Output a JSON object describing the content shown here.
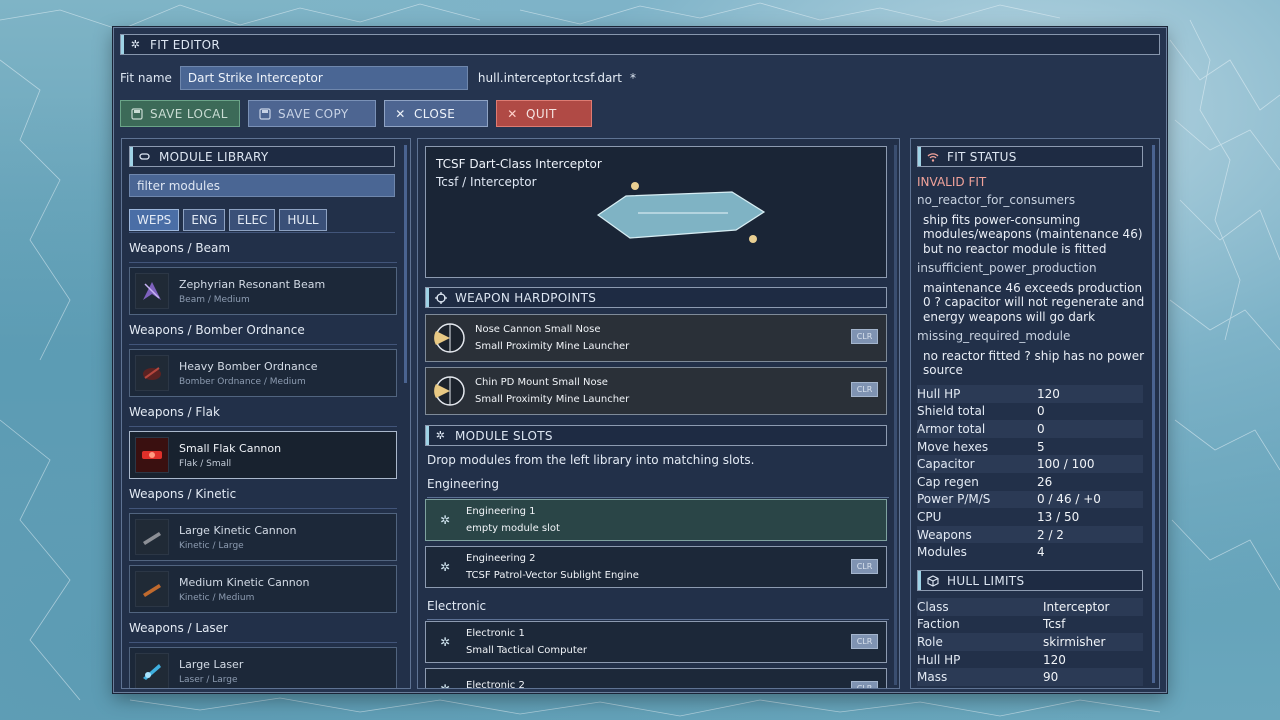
{
  "window": {
    "title": "FIT EDITOR"
  },
  "fit": {
    "name_label": "Fit name",
    "name_value": "Dart Strike Interceptor",
    "filename": "hull.interceptor.tcsf.dart",
    "dirty_marker": "*"
  },
  "toolbar": {
    "save_local": "SAVE LOCAL",
    "save_copy": "SAVE COPY",
    "close": "CLOSE",
    "quit": "QUIT"
  },
  "library": {
    "title": "MODULE LIBRARY",
    "filter_placeholder": "filter modules",
    "tabs": [
      "WEPS",
      "ENG",
      "ELEC",
      "HULL"
    ],
    "groups": [
      {
        "label": "Weapons / Beam",
        "items": [
          {
            "name": "Zephyrian Resonant Beam",
            "sub": "Beam / Medium",
            "accent": "#8f6bd6"
          }
        ]
      },
      {
        "label": "Weapons / Bomber Ordnance",
        "items": [
          {
            "name": "Heavy Bomber Ordnance",
            "sub": "Bomber Ordnance / Medium",
            "accent": "#b5463d"
          }
        ]
      },
      {
        "label": "Weapons / Flak",
        "items": [
          {
            "name": "Small Flak Cannon",
            "sub": "Flak / Small",
            "accent": "#e0302a"
          }
        ]
      },
      {
        "label": "Weapons / Kinetic",
        "items": [
          {
            "name": "Large Kinetic Cannon",
            "sub": "Kinetic / Large",
            "accent": "#8c8f96"
          },
          {
            "name": "Medium Kinetic Cannon",
            "sub": "Kinetic / Medium",
            "accent": "#c06a2e"
          }
        ]
      },
      {
        "label": "Weapons / Laser",
        "items": [
          {
            "name": "Large Laser",
            "sub": "Laser / Large",
            "accent": "#3fb0e0"
          }
        ]
      }
    ]
  },
  "preview": {
    "ship_name": "TCSF Dart-Class Interceptor",
    "ship_class": "Tcsf / Interceptor"
  },
  "hardpoints": {
    "title": "WEAPON HARDPOINTS",
    "items": [
      {
        "title": "Nose Cannon  Small  Nose",
        "weapon": "Small Proximity Mine Launcher",
        "clear": "CLR"
      },
      {
        "title": "Chin PD Mount  Small  Nose",
        "weapon": "Small Proximity Mine Launcher",
        "clear": "CLR"
      }
    ]
  },
  "slots": {
    "title": "MODULE SLOTS",
    "hint": "Drop modules from the left library into matching slots.",
    "engineering_label": "Engineering",
    "electronic_label": "Electronic",
    "engineering": [
      {
        "name": "Engineering 1",
        "module": "empty module slot",
        "clear": ""
      },
      {
        "name": "Engineering 2",
        "module": "TCSF Patrol-Vector Sublight Engine",
        "clear": "CLR"
      }
    ],
    "electronic": [
      {
        "name": "Electronic 1",
        "module": "Small Tactical Computer",
        "clear": "CLR"
      },
      {
        "name": "Electronic 2",
        "module": "",
        "clear": "CLR"
      }
    ]
  },
  "status": {
    "title": "FIT STATUS",
    "state": "INVALID FIT",
    "issues": [
      {
        "code": "no_reactor_for_consumers",
        "desc": "ship fits power-consuming modules/weapons (maintenance 46) but no reactor module is fitted"
      },
      {
        "code": "insufficient_power_production",
        "desc": "maintenance 46 exceeds production 0 ? capacitor will not regenerate and energy weapons will go dark"
      },
      {
        "code": "missing_required_module",
        "desc": "no reactor fitted ? ship has no power source"
      }
    ],
    "stats": [
      {
        "label": "Hull HP",
        "value": "120"
      },
      {
        "label": "Shield total",
        "value": "0"
      },
      {
        "label": "Armor total",
        "value": "0"
      },
      {
        "label": "Move hexes",
        "value": "5"
      },
      {
        "label": "Capacitor",
        "value": "100 / 100"
      },
      {
        "label": "Cap regen",
        "value": "26"
      },
      {
        "label": "Power P/M/S",
        "value": "0 / 46 / +0"
      },
      {
        "label": "CPU",
        "value": "13 / 50"
      },
      {
        "label": "Weapons",
        "value": "2 / 2"
      },
      {
        "label": "Modules",
        "value": "4"
      }
    ]
  },
  "limits": {
    "title": "HULL LIMITS",
    "rows": [
      {
        "label": "Class",
        "value": "Interceptor"
      },
      {
        "label": "Faction",
        "value": "Tcsf"
      },
      {
        "label": "Role",
        "value": "skirmisher"
      },
      {
        "label": "Hull HP",
        "value": "120"
      },
      {
        "label": "Mass",
        "value": "90"
      }
    ]
  },
  "colors": {
    "accent": "#9fd3e6",
    "invalid": "#f0a29a",
    "quit": "#b04a45",
    "save_local": "#3c6a58"
  }
}
